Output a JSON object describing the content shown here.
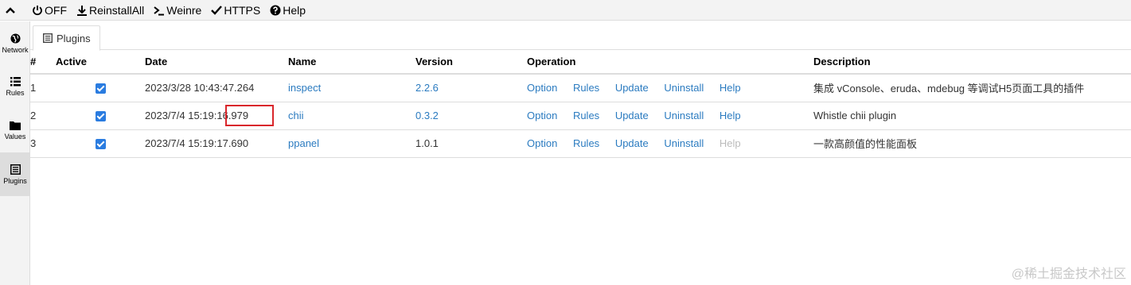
{
  "toolbar": {
    "items": [
      {
        "label": "OFF",
        "icon": "power-icon"
      },
      {
        "label": "ReinstallAll",
        "icon": "download-icon"
      },
      {
        "label": "Weinre",
        "icon": "terminal-icon"
      },
      {
        "label": "HTTPS",
        "icon": "check-icon"
      },
      {
        "label": "Help",
        "icon": "question-circle-icon"
      }
    ]
  },
  "sidebar": {
    "items": [
      {
        "label": "Network",
        "icon": "globe-icon"
      },
      {
        "label": "Rules",
        "icon": "list-icon"
      },
      {
        "label": "Values",
        "icon": "folder-icon"
      },
      {
        "label": "Plugins",
        "icon": "list-alt-icon",
        "active": true
      }
    ]
  },
  "tab": {
    "label": "Plugins",
    "icon": "list-alt-icon"
  },
  "table": {
    "headers": {
      "num": "#",
      "active": "Active",
      "date": "Date",
      "name": "Name",
      "version": "Version",
      "operation": "Operation",
      "description": "Description"
    },
    "rows": [
      {
        "num": "1",
        "active": true,
        "date": "2023/3/28 10:43:47.264",
        "name": "inspect",
        "version": "2.2.6",
        "version_link": true,
        "ops": [
          "Option",
          "Rules",
          "Update",
          "Uninstall",
          "Help"
        ],
        "help_enabled": true,
        "description": "集成 vConsole、eruda、mdebug 等调试H5页面工具的插件"
      },
      {
        "num": "2",
        "active": true,
        "date": "2023/7/4 15:19:16.979",
        "name": "chii",
        "version": "0.3.2",
        "version_link": true,
        "ops": [
          "Option",
          "Rules",
          "Update",
          "Uninstall",
          "Help"
        ],
        "help_enabled": true,
        "description": "Whistle chii plugin"
      },
      {
        "num": "3",
        "active": true,
        "date": "2023/7/4 15:19:17.690",
        "name": "ppanel",
        "version": "1.0.1",
        "version_link": false,
        "ops": [
          "Option",
          "Rules",
          "Update",
          "Uninstall",
          "Help"
        ],
        "help_enabled": false,
        "description": "一款高颜值的性能面板"
      }
    ]
  },
  "colors": {
    "link": "#2b7bc0",
    "highlight": "#d9262b",
    "checkbox": "#2a7ce0"
  },
  "watermark": "@稀土掘金技术社区"
}
